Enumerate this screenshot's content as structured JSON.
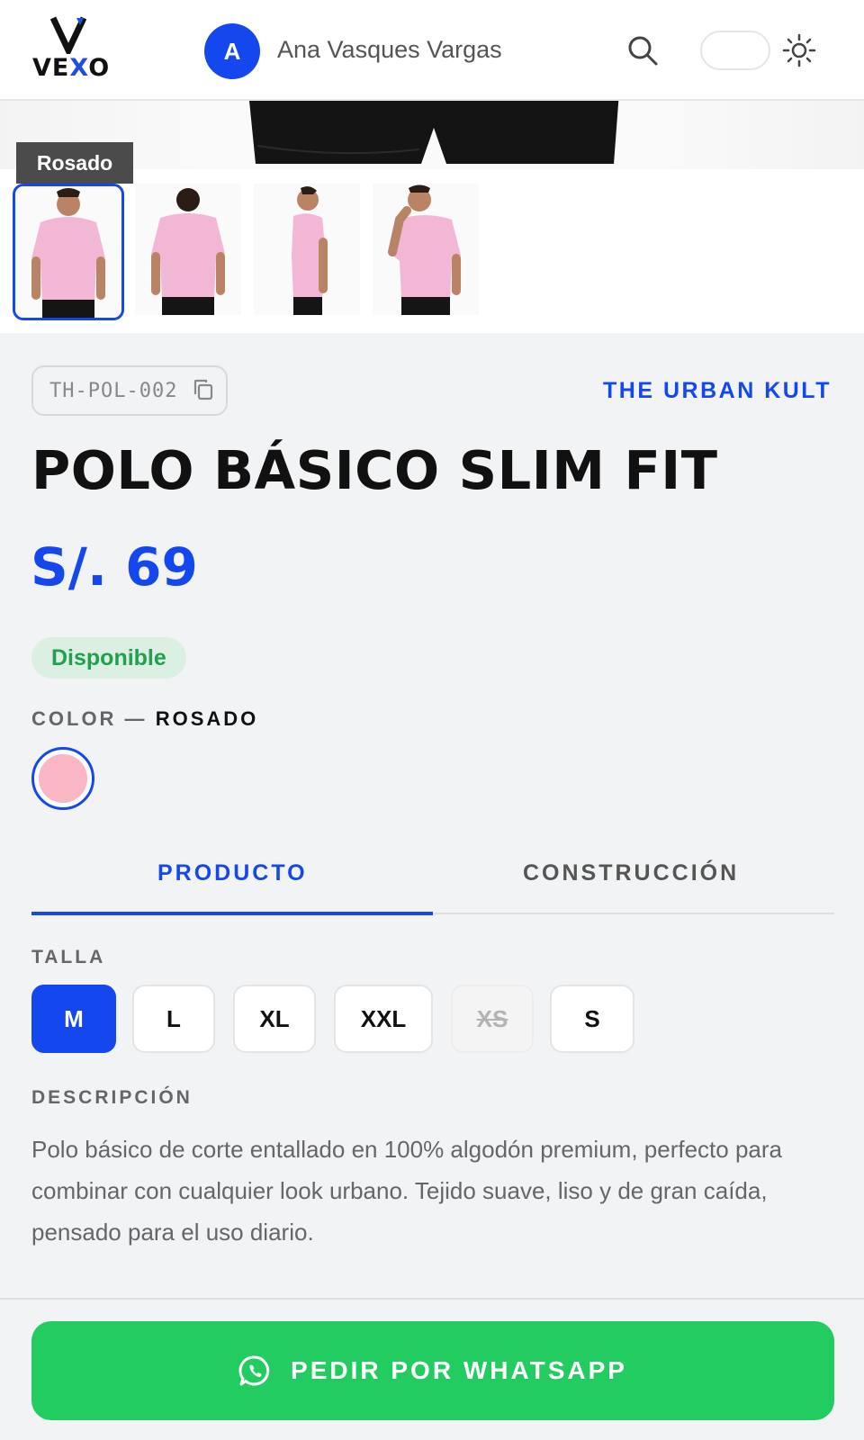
{
  "header": {
    "logo_text": "VEXO",
    "logo_letter": "V",
    "avatar_initial": "A",
    "user_name": "Ana Vasques Vargas",
    "search_icon": "search-icon",
    "theme_icon": "sun-icon"
  },
  "gallery": {
    "selected_color_tag": "Rosado",
    "thumbnails": [
      {
        "name": "thumb-front",
        "selected": true
      },
      {
        "name": "thumb-back",
        "selected": false
      },
      {
        "name": "thumb-side",
        "selected": false
      },
      {
        "name": "thumb-pose",
        "selected": false
      }
    ]
  },
  "product": {
    "sku": "TH-POL-002",
    "brand": "THE URBAN KULT",
    "title": "POLO BÁSICO SLIM FIT",
    "price": "S/. 69",
    "stock_status": "Disponible",
    "color_label": "COLOR —",
    "color_value": "ROSADO",
    "color_swatch": "#f9b6c3"
  },
  "tabs": [
    {
      "label": "PRODUCTO",
      "active": true
    },
    {
      "label": "CONSTRUCCIÓN",
      "active": false
    }
  ],
  "sizes": {
    "label": "TALLA",
    "options": [
      {
        "label": "M",
        "state": "selected"
      },
      {
        "label": "L",
        "state": "available"
      },
      {
        "label": "XL",
        "state": "available"
      },
      {
        "label": "XXL",
        "state": "available"
      },
      {
        "label": "XS",
        "state": "unavailable"
      },
      {
        "label": "S",
        "state": "available"
      }
    ]
  },
  "description": {
    "label": "DESCRIPCIÓN",
    "text": "Polo básico de corte entallado en 100% algodón premium, perfecto para combinar con cualquier look urbano. Tejido suave, liso y de gran caída, pensado para el uso diario."
  },
  "cta": {
    "label": "PEDIR POR WHATSAPP",
    "icon": "whatsapp-icon"
  },
  "colors": {
    "accent": "#1547ee",
    "success": "#22a04d",
    "whatsapp": "#22cc60"
  }
}
